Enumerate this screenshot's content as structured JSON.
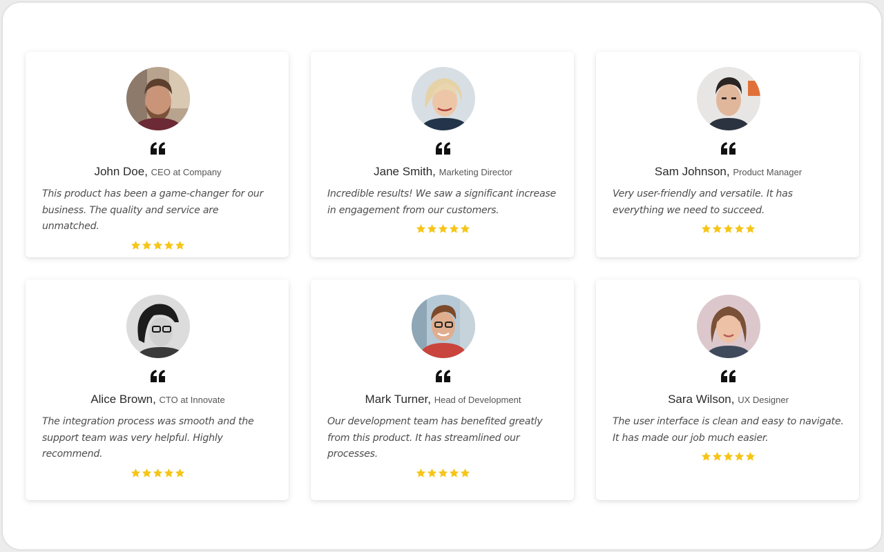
{
  "accent": {
    "star_color": "#f5c518"
  },
  "testimonials": [
    {
      "name": "John Doe,",
      "role": "CEO at Company",
      "text": "This product has been a game-changer for our business. The quality and service are unmatched.",
      "rating": 5,
      "avatar": "avatar-photo"
    },
    {
      "name": "Jane Smith,",
      "role": "Marketing Director",
      "text": "Incredible results! We saw a significant increase in engagement from our customers.",
      "rating": 5,
      "avatar": "avatar-photo"
    },
    {
      "name": "Sam Johnson,",
      "role": "Product Manager",
      "text": "Very user-friendly and versatile. It has everything we need to succeed.",
      "rating": 5,
      "avatar": "avatar-photo"
    },
    {
      "name": "Alice Brown,",
      "role": "CTO at Innovate",
      "text": "The integration process was smooth and the support team was very helpful. Highly recommend.",
      "rating": 5,
      "avatar": "avatar-photo"
    },
    {
      "name": "Mark Turner,",
      "role": "Head of Development",
      "text": "Our development team has benefited greatly from this product. It has streamlined our processes.",
      "rating": 5,
      "avatar": "avatar-photo"
    },
    {
      "name": "Sara Wilson,",
      "role": "UX Designer",
      "text": "The user interface is clean and easy to navigate. It has made our job much easier.",
      "rating": 5,
      "avatar": "avatar-photo"
    }
  ]
}
